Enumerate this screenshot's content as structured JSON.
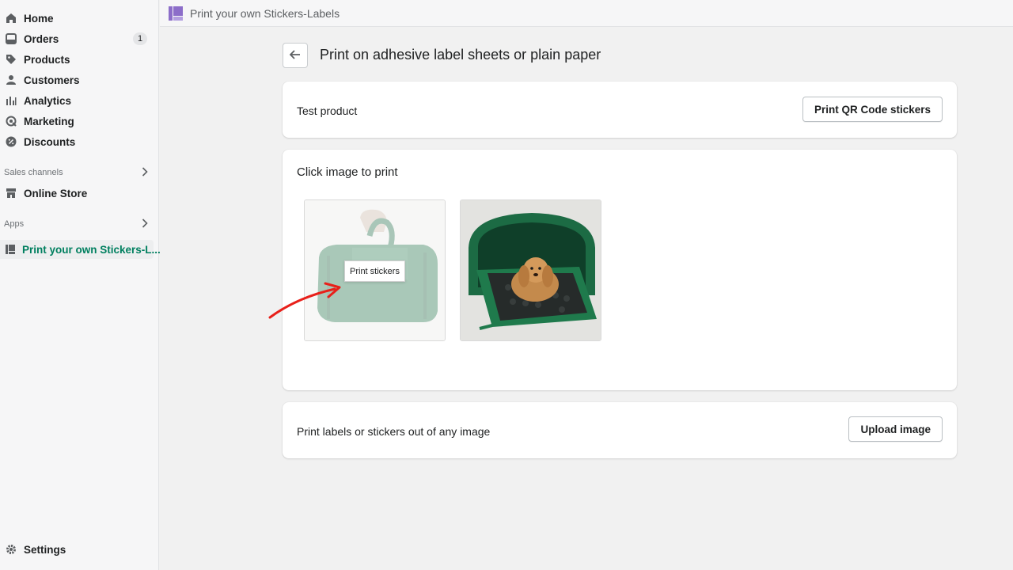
{
  "sidebar": {
    "items": [
      {
        "label": "Home",
        "icon": "home-icon"
      },
      {
        "label": "Orders",
        "icon": "orders-icon",
        "badge": "1"
      },
      {
        "label": "Products",
        "icon": "tag-icon"
      },
      {
        "label": "Customers",
        "icon": "person-icon"
      },
      {
        "label": "Analytics",
        "icon": "bar-chart-icon"
      },
      {
        "label": "Marketing",
        "icon": "target-icon"
      },
      {
        "label": "Discounts",
        "icon": "discount-icon"
      }
    ],
    "sales_channels_label": "Sales channels",
    "online_store_label": "Online Store",
    "apps_label": "Apps",
    "app_item_label": "Print your own Stickers-L...",
    "settings_label": "Settings"
  },
  "topbar": {
    "title": "Print your own Stickers-Labels"
  },
  "page": {
    "title": "Print on adhesive label sheets or plain paper"
  },
  "product_card": {
    "product_name": "Test product",
    "qr_button": "Print QR Code stickers"
  },
  "images_card": {
    "heading": "Click image to print",
    "tooltip": "Print stickers"
  },
  "upload_card": {
    "text": "Print labels or stickers out of any image",
    "upload_button": "Upload image"
  },
  "colors": {
    "accent_green": "#007f5f",
    "annotation_red": "#e8201a",
    "app_icon_purple": "#8c6dc9"
  }
}
